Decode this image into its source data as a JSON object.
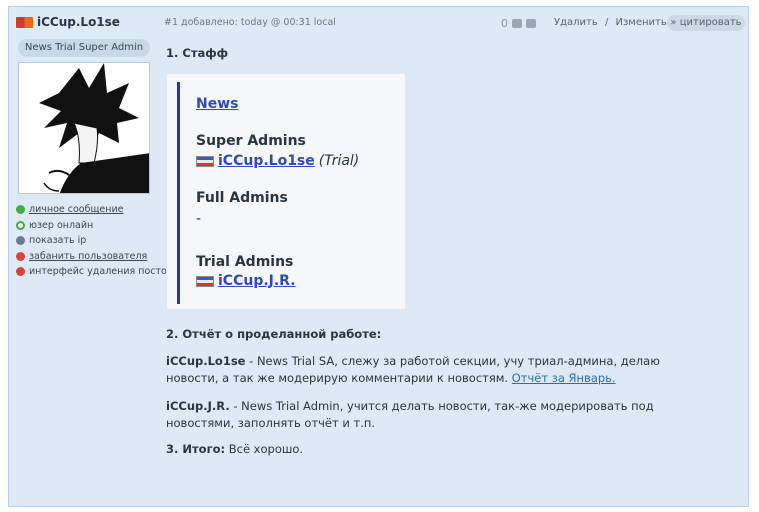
{
  "post": {
    "author": "iCCup.Lo1se",
    "rank": "News Trial Super Admin",
    "meta": "#1 добавлено: today @ 00:31 local",
    "votes": "0",
    "actions": {
      "delete": "Удалить",
      "sep": "/",
      "edit": "Изменить"
    },
    "quote_label": "цитировать"
  },
  "sidebar_links": [
    {
      "label": "личное сообщение",
      "icon": "message-icon"
    },
    {
      "label": "юзер онлайн",
      "icon": "online-icon"
    },
    {
      "label": "показать ip",
      "icon": "ip-icon"
    },
    {
      "label": "забанить пользователя",
      "icon": "ban-icon"
    },
    {
      "label": "интерфейс удаления постов",
      "icon": "delete-posts-icon"
    }
  ],
  "content": {
    "staff_heading": "1. Стафф",
    "staff_box": {
      "news_link": "News",
      "super_admins_heading": "Super Admins",
      "super_admin_name": "iCCup.Lo1se",
      "super_admin_note": "(Trial)",
      "full_admins_heading": "Full Admins",
      "full_admins_empty": "-",
      "trial_admins_heading": "Trial Admins",
      "trial_admin_name": "iCCup.J.R."
    },
    "report_heading": "2. Отчёт о проделанной работе:",
    "p1_name": "iCCup.Lo1se",
    "p1_text": " - News Trial SA, слежу за работой секции, учу триал-админа, делаю новости, а так же модерирую комментарии к новостям. ",
    "p1_link": "Отчёт за Январь.",
    "p2_name": "iCCup.J.R.",
    "p2_text": " - News Trial Admin, учится делать новости, так-же модерировать под новостями, заполнять отчёт и т.п.",
    "summary_label": "3. Итого:",
    "summary_text": " Всё хорошо."
  },
  "colors": {
    "accent": "#2d4bb3",
    "panel": "#dde9f4",
    "bar": "#1f3fa0"
  }
}
